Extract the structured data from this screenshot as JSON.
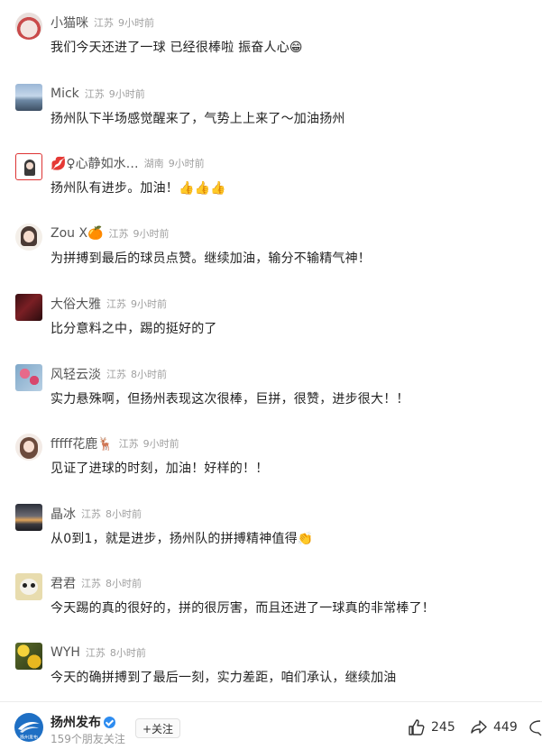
{
  "comments": [
    {
      "name": "小猫咪",
      "location": "江苏",
      "time": "9小时前",
      "text": "我们今天还进了一球 已经很棒啦 振奋人心",
      "emoji": "😁"
    },
    {
      "name": "Mick",
      "location": "江苏",
      "time": "9小时前",
      "text": "扬州队下半场感觉醒来了，气势上上来了～加油扬州",
      "emoji": ""
    },
    {
      "name": "💋♀心静如水…",
      "location": "湖南",
      "time": "9小时前",
      "text": "扬州队有进步。加油！",
      "emoji": "👍👍👍"
    },
    {
      "name": "Zou X🍊",
      "location": "江苏",
      "time": "9小时前",
      "text": "为拼搏到最后的球员点赞。继续加油，输分不输精气神！",
      "emoji": ""
    },
    {
      "name": "大俗大雅",
      "location": "江苏",
      "time": "9小时前",
      "text": "比分意料之中，踢的挺好的了",
      "emoji": ""
    },
    {
      "name": "风轻云淡",
      "location": "江苏",
      "time": "8小时前",
      "text": "实力悬殊啊，但扬州表现这次很棒，巨拼，很赞，进步很大！！",
      "emoji": ""
    },
    {
      "name": "fffff花鹿🦌",
      "location": "江苏",
      "time": "9小时前",
      "text": "见证了进球的时刻，加油！好样的！！",
      "emoji": ""
    },
    {
      "name": "晶冰",
      "location": "江苏",
      "time": "8小时前",
      "text": "从0到1，就是进步，扬州队的拼搏精神值得",
      "emoji": "👏"
    },
    {
      "name": "君君",
      "location": "江苏",
      "time": "8小时前",
      "text": "今天踢的真的很好的，拼的很厉害，而且还进了一球真的非常棒了！",
      "emoji": ""
    },
    {
      "name": "WYH",
      "location": "江苏",
      "time": "8小时前",
      "text": "今天的确拼搏到了最后一刻，实力差距，咱们承认，继续加油",
      "emoji": ""
    }
  ],
  "footer": {
    "account_name": "扬州发布",
    "friends_follow": "159个朋友关注",
    "follow_label": "+关注",
    "like_count": "245",
    "share_count": "449",
    "logo_text": "扬州发布"
  },
  "icons": {
    "verified": "verified-badge-icon",
    "like": "thumbs-up-icon",
    "share": "share-arrow-icon",
    "comment": "comment-bubble-icon"
  },
  "colors": {
    "accent": "#1e6fc4",
    "meta_gray": "#a0a0a0",
    "verified_blue": "#2d8cf0"
  }
}
